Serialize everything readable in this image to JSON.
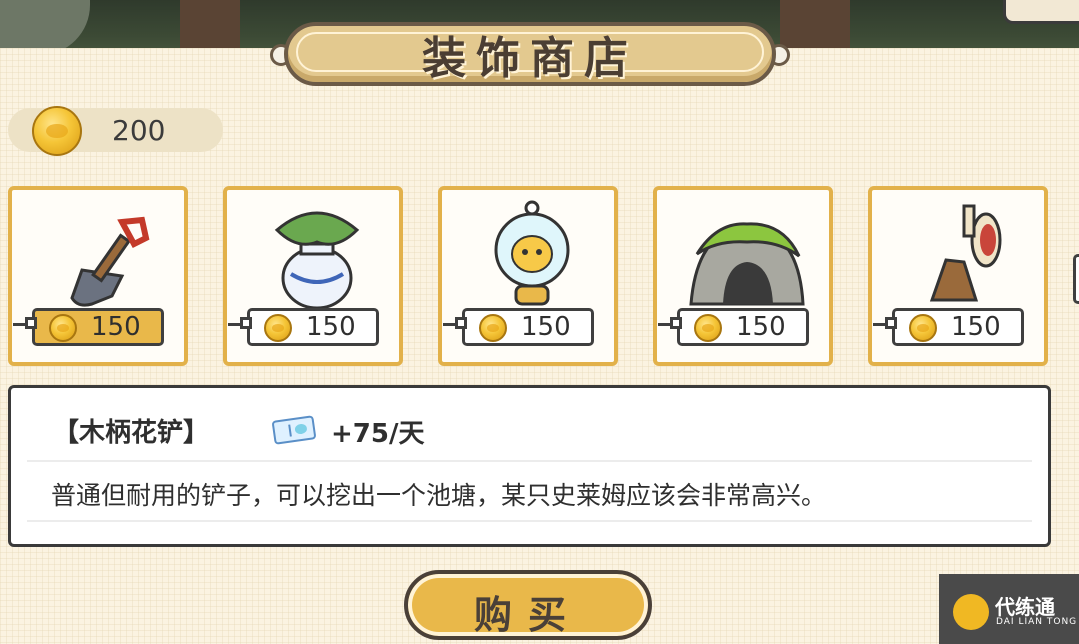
{
  "shop": {
    "title": "装饰商店",
    "balance": "200"
  },
  "items": [
    {
      "name": "shovel",
      "price": "150",
      "selected": true
    },
    {
      "name": "plant-vase",
      "price": "150",
      "selected": false
    },
    {
      "name": "crystal-lamp",
      "price": "150",
      "selected": false
    },
    {
      "name": "mossy-cave",
      "price": "150",
      "selected": false
    },
    {
      "name": "target-stand",
      "price": "150",
      "selected": false
    }
  ],
  "detail": {
    "item_name": "【木柄花铲】",
    "reward": "+75/天",
    "description": "普通但耐用的铲子，可以挖出一个池塘，某只史莱姆应该会非常高兴。"
  },
  "buy_button": {
    "label": "购买"
  },
  "colors": {
    "accent_gold": "#e9b84a",
    "card_border": "#e2b14a",
    "panel_bg": "#fbf3e1",
    "outline": "#3a3a3a"
  },
  "watermark": {
    "title": "代练通",
    "subtitle": "DAI LIAN TONG"
  }
}
